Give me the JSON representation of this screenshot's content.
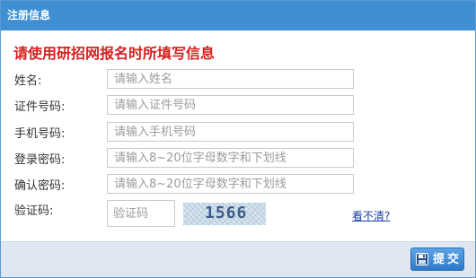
{
  "window": {
    "title": "注册信息"
  },
  "form": {
    "heading": "请使用研招网报名时所填写信息",
    "fields": [
      {
        "label": "姓名:",
        "placeholder": "请输入姓名"
      },
      {
        "label": "证件号码:",
        "placeholder": "请输入证件号码"
      },
      {
        "label": "手机号码:",
        "placeholder": "请输入手机号码"
      },
      {
        "label": "登录密码:",
        "placeholder": "请输入8~20位字母数字和下划线"
      },
      {
        "label": "确认密码:",
        "placeholder": "请输入8~20位字母数字和下划线"
      }
    ],
    "captcha": {
      "label": "验证码:",
      "placeholder": "验证码",
      "image_text": "1566",
      "refresh_link": "看不清?"
    }
  },
  "footer": {
    "submit_label": "提交",
    "submit_icon": "save-icon"
  }
}
